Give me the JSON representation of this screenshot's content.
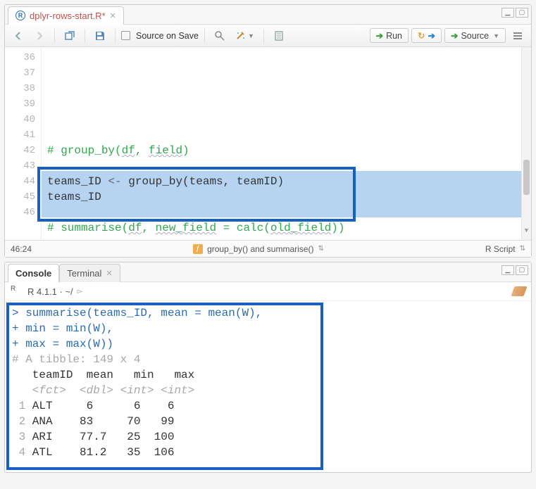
{
  "editor": {
    "tab_title": "dplyr-rows-start.R*",
    "source_on_save": "Source on Save",
    "run": "Run",
    "source": "Source",
    "cursor": "46:24",
    "func_scope": "group_by() and summarise()",
    "lang": "R Script",
    "lines": [
      {
        "n": 36,
        "type": "blank",
        "text": ""
      },
      {
        "n": 37,
        "type": "comment",
        "text": "# group_by(df, field)"
      },
      {
        "n": 38,
        "type": "blank",
        "text": ""
      },
      {
        "n": 39,
        "type": "code",
        "text": "teams_ID <- group_by(teams, teamID)"
      },
      {
        "n": 40,
        "type": "code",
        "text": "teams_ID"
      },
      {
        "n": 41,
        "type": "blank",
        "text": ""
      },
      {
        "n": 42,
        "type": "comment",
        "text": "# summarise(df, new_field = calc(old_field))"
      },
      {
        "n": 43,
        "type": "blank",
        "text": ""
      },
      {
        "n": 44,
        "type": "code",
        "text": "summarise(teams_ID, mean = mean(W),"
      },
      {
        "n": 45,
        "type": "code",
        "text": "          min = min(W),"
      },
      {
        "n": 46,
        "type": "code",
        "text": "          max = max(W))"
      }
    ]
  },
  "console": {
    "tab_console": "Console",
    "tab_terminal": "Terminal",
    "r_version": "R 4.1.1 · ~/",
    "cmd1": "summarise(teams_ID, mean = mean(W),",
    "cmd2": "          min = min(W),",
    "cmd3": "          max = max(W))",
    "tibble": "# A tibble: 149 x 4",
    "header": "   teamID  mean   min   max",
    "types": "   <fct>  <dbl> <int> <int>",
    "rows": [
      {
        "i": " 1",
        "team": "ALT",
        "mean": "   6  ",
        "min": "    6",
        "max": "    6"
      },
      {
        "i": " 2",
        "team": "ANA",
        "mean": "  83  ",
        "min": "   70",
        "max": "   99"
      },
      {
        "i": " 3",
        "team": "ARI",
        "mean": "  77.7",
        "min": "   25",
        "max": "  100"
      },
      {
        "i": " 4",
        "team": "ATL",
        "mean": "  81.2",
        "min": "   35",
        "max": "  106"
      }
    ]
  },
  "chart_data": {
    "type": "table",
    "title": "A tibble: 149 x 4",
    "columns": [
      "teamID",
      "mean",
      "min",
      "max"
    ],
    "col_types": [
      "fct",
      "dbl",
      "int",
      "int"
    ],
    "rows_shown": [
      {
        "teamID": "ALT",
        "mean": 6,
        "min": 6,
        "max": 6
      },
      {
        "teamID": "ANA",
        "mean": 83,
        "min": 70,
        "max": 99
      },
      {
        "teamID": "ARI",
        "mean": 77.7,
        "min": 25,
        "max": 100
      },
      {
        "teamID": "ATL",
        "mean": 81.2,
        "min": 35,
        "max": 106
      }
    ],
    "total_rows": 149
  }
}
